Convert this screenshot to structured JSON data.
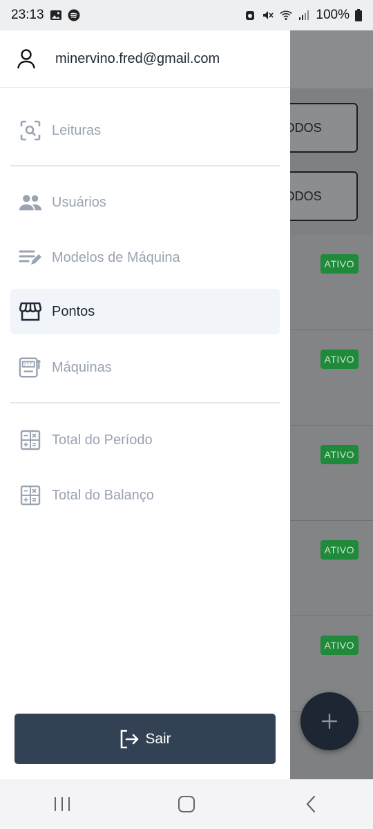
{
  "status_bar": {
    "time": "23:13",
    "battery": "100%",
    "icons": [
      "gallery-icon",
      "spotify-icon",
      "alarm-icon",
      "mute-icon",
      "wifi-icon",
      "signal-icon",
      "battery-icon"
    ]
  },
  "background": {
    "filters": [
      "TODOS",
      "TODOS"
    ],
    "badges": [
      "ATIVO",
      "ATIVO",
      "ATIVO",
      "ATIVO",
      "ATIVO"
    ],
    "fab_icon": "plus-icon"
  },
  "drawer": {
    "user_email": "minervino.fred@gmail.com",
    "items": [
      {
        "label": "Leituras",
        "icon": "scan-icon",
        "active": false
      },
      {
        "label": "Usuários",
        "icon": "users-icon",
        "active": false
      },
      {
        "label": "Modelos de Máquina",
        "icon": "edit-list-icon",
        "active": false
      },
      {
        "label": "Pontos",
        "icon": "store-icon",
        "active": true
      },
      {
        "label": "Máquinas",
        "icon": "slot-machine-icon",
        "active": false
      },
      {
        "label": "Total do Período",
        "icon": "calculator-icon",
        "active": false
      },
      {
        "label": "Total do Balanço",
        "icon": "calculator-icon",
        "active": false
      }
    ],
    "logout_label": "Sair"
  },
  "colors": {
    "primary": "#334155",
    "inactive_text": "#9aa3b2",
    "active_bg": "#f1f4f8",
    "badge": "#1e8a3a"
  }
}
